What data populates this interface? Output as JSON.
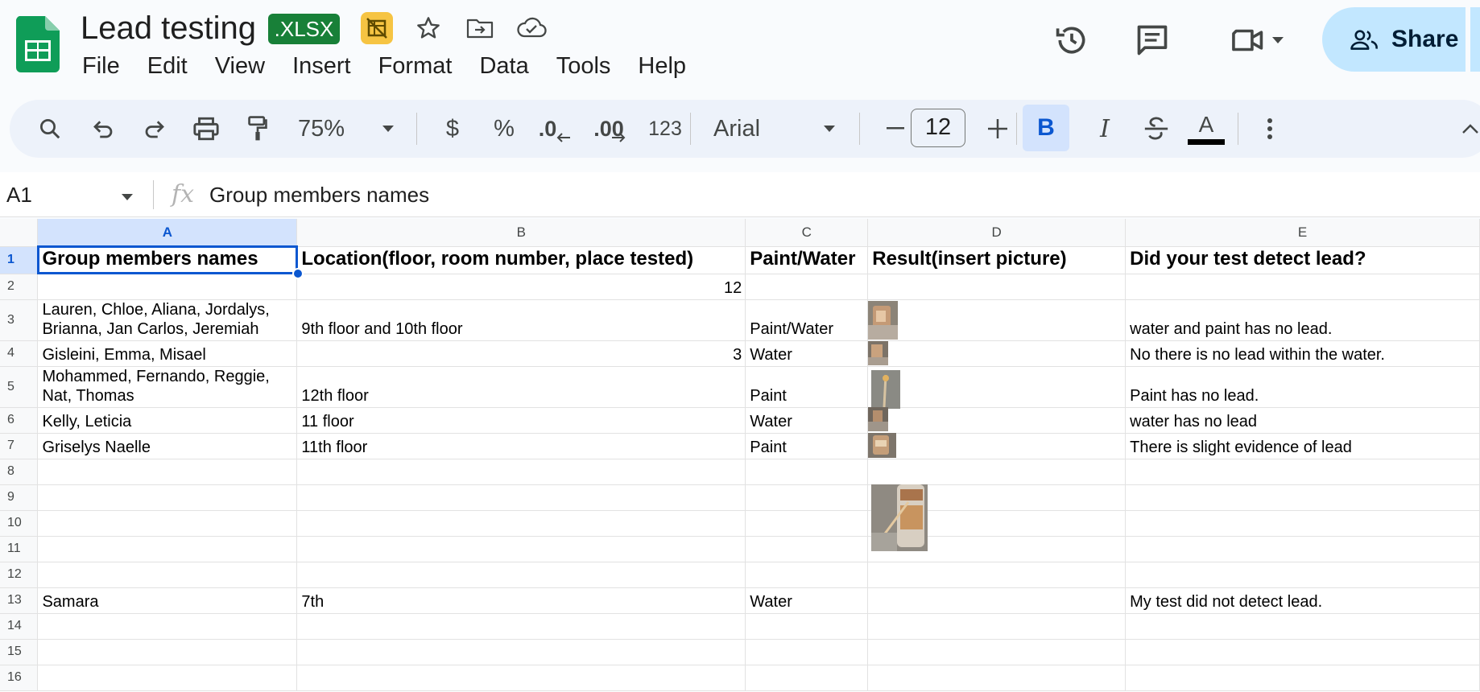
{
  "app": {
    "doc_title": "Lead testing",
    "file_badge": ".XLSX",
    "menu": [
      "File",
      "Edit",
      "View",
      "Insert",
      "Format",
      "Data",
      "Tools",
      "Help"
    ],
    "share_label": "Share"
  },
  "toolbar": {
    "zoom": "75%",
    "currency": "$",
    "percent": "%",
    "decrease_decimal": ".0",
    "increase_decimal": ".00",
    "number_format": "123",
    "font": "Arial",
    "font_size": "12",
    "minus": "–",
    "plus": "+",
    "bold": "B",
    "italic": "I",
    "text_color_letter": "A"
  },
  "formula_bar": {
    "cell_ref": "A1",
    "fx": "fx",
    "content": "Group members names"
  },
  "sheet": {
    "columns": [
      "A",
      "B",
      "C",
      "D",
      "E"
    ],
    "row_numbers": [
      "1",
      "2",
      "3",
      "4",
      "5",
      "6",
      "7",
      "8",
      "9",
      "10",
      "11",
      "12",
      "13",
      "14",
      "15",
      "16"
    ],
    "header": {
      "a": "Group members names",
      "b": "Location(floor, room number, place tested)",
      "c": "Paint/Water",
      "d": "Result(insert picture)",
      "e": "Did your test detect lead?"
    },
    "rows": [
      {
        "a": "",
        "b": "12",
        "c": "",
        "e": ""
      },
      {
        "a": "Lauren, Chloe, Aliana, Jordalys, Brianna, Jan Carlos, Jeremiah",
        "b": "9th floor and 10th floor",
        "c": "Paint/Water",
        "e": "water and paint has no lead."
      },
      {
        "a": "Gisleini, Emma, Misael",
        "b": "3",
        "c": "Water",
        "e": "No there is no lead within the water."
      },
      {
        "a": "Mohammed, Fernando, Reggie, Nat, Thomas",
        "b": "12th floor",
        "c": "Paint",
        "e": "Paint has no lead."
      },
      {
        "a": "Kelly, Leticia",
        "b": "11 floor",
        "c": "Water",
        "e": "water has no lead"
      },
      {
        "a": "Griselys Naelle",
        "b": "11th floor",
        "c": "Paint",
        "e": "There is slight evidence of lead"
      },
      {
        "a": "",
        "b": "",
        "c": "",
        "e": ""
      },
      {
        "a": "",
        "b": "",
        "c": "",
        "e": ""
      },
      {
        "a": "",
        "b": "",
        "c": "",
        "e": ""
      },
      {
        "a": "",
        "b": "",
        "c": "",
        "e": ""
      },
      {
        "a": "",
        "b": "",
        "c": "",
        "e": ""
      },
      {
        "a": "Samara",
        "b": "7th",
        "c": "Water",
        "e": "My test did not detect lead."
      },
      {
        "a": "",
        "b": "",
        "c": "",
        "e": ""
      },
      {
        "a": "",
        "b": "",
        "c": "",
        "e": ""
      },
      {
        "a": "",
        "b": "",
        "c": "",
        "e": ""
      }
    ]
  },
  "colors": {
    "xlsx_badge": "#188038",
    "share_bg": "#c2e7ff",
    "selection": "#0b57d0",
    "selected_header_bg": "#d3e3fd",
    "toolbar_bg": "#edf2fa"
  }
}
